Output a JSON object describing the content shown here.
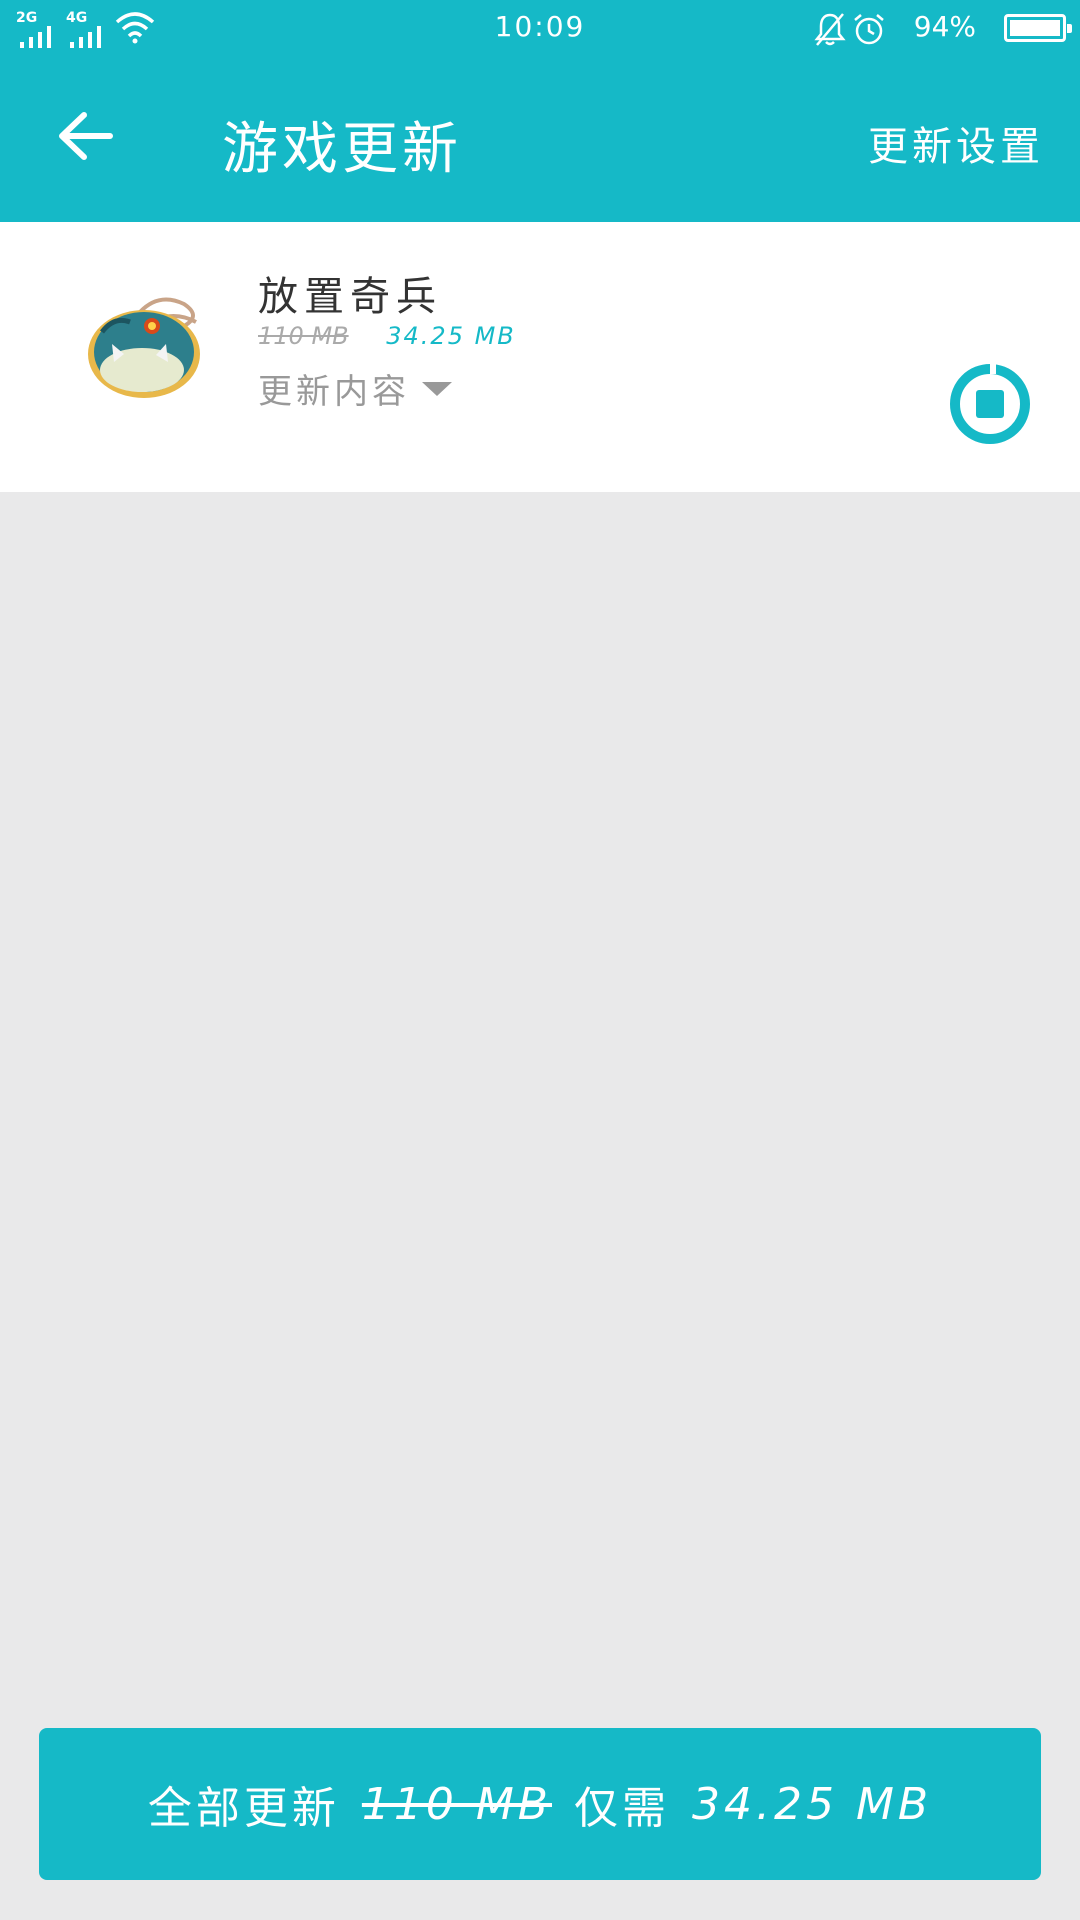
{
  "status_bar": {
    "sim1_label": "2G",
    "sim2_label": "4G",
    "time": "10:09",
    "battery": "94%",
    "icons": [
      "signal-icon",
      "signal-icon",
      "wifi-icon",
      "bell-mute-icon",
      "alarm-icon",
      "battery-icon"
    ]
  },
  "app_bar": {
    "title": "游戏更新",
    "settings": "更新设置",
    "back_icon": "back-arrow-icon"
  },
  "updates": [
    {
      "name": "放置奇兵",
      "old_size": "110 MB",
      "new_size": "34.25 MB",
      "changelog_label": "更新内容",
      "action_icon": "stop-download-icon"
    }
  ],
  "footer": {
    "label": "全部更新",
    "old_total": "110 MB",
    "need_label": "仅需",
    "new_total": "34.25 MB"
  },
  "colors": {
    "accent": "#15b9c7",
    "background": "#e9e9ea"
  }
}
